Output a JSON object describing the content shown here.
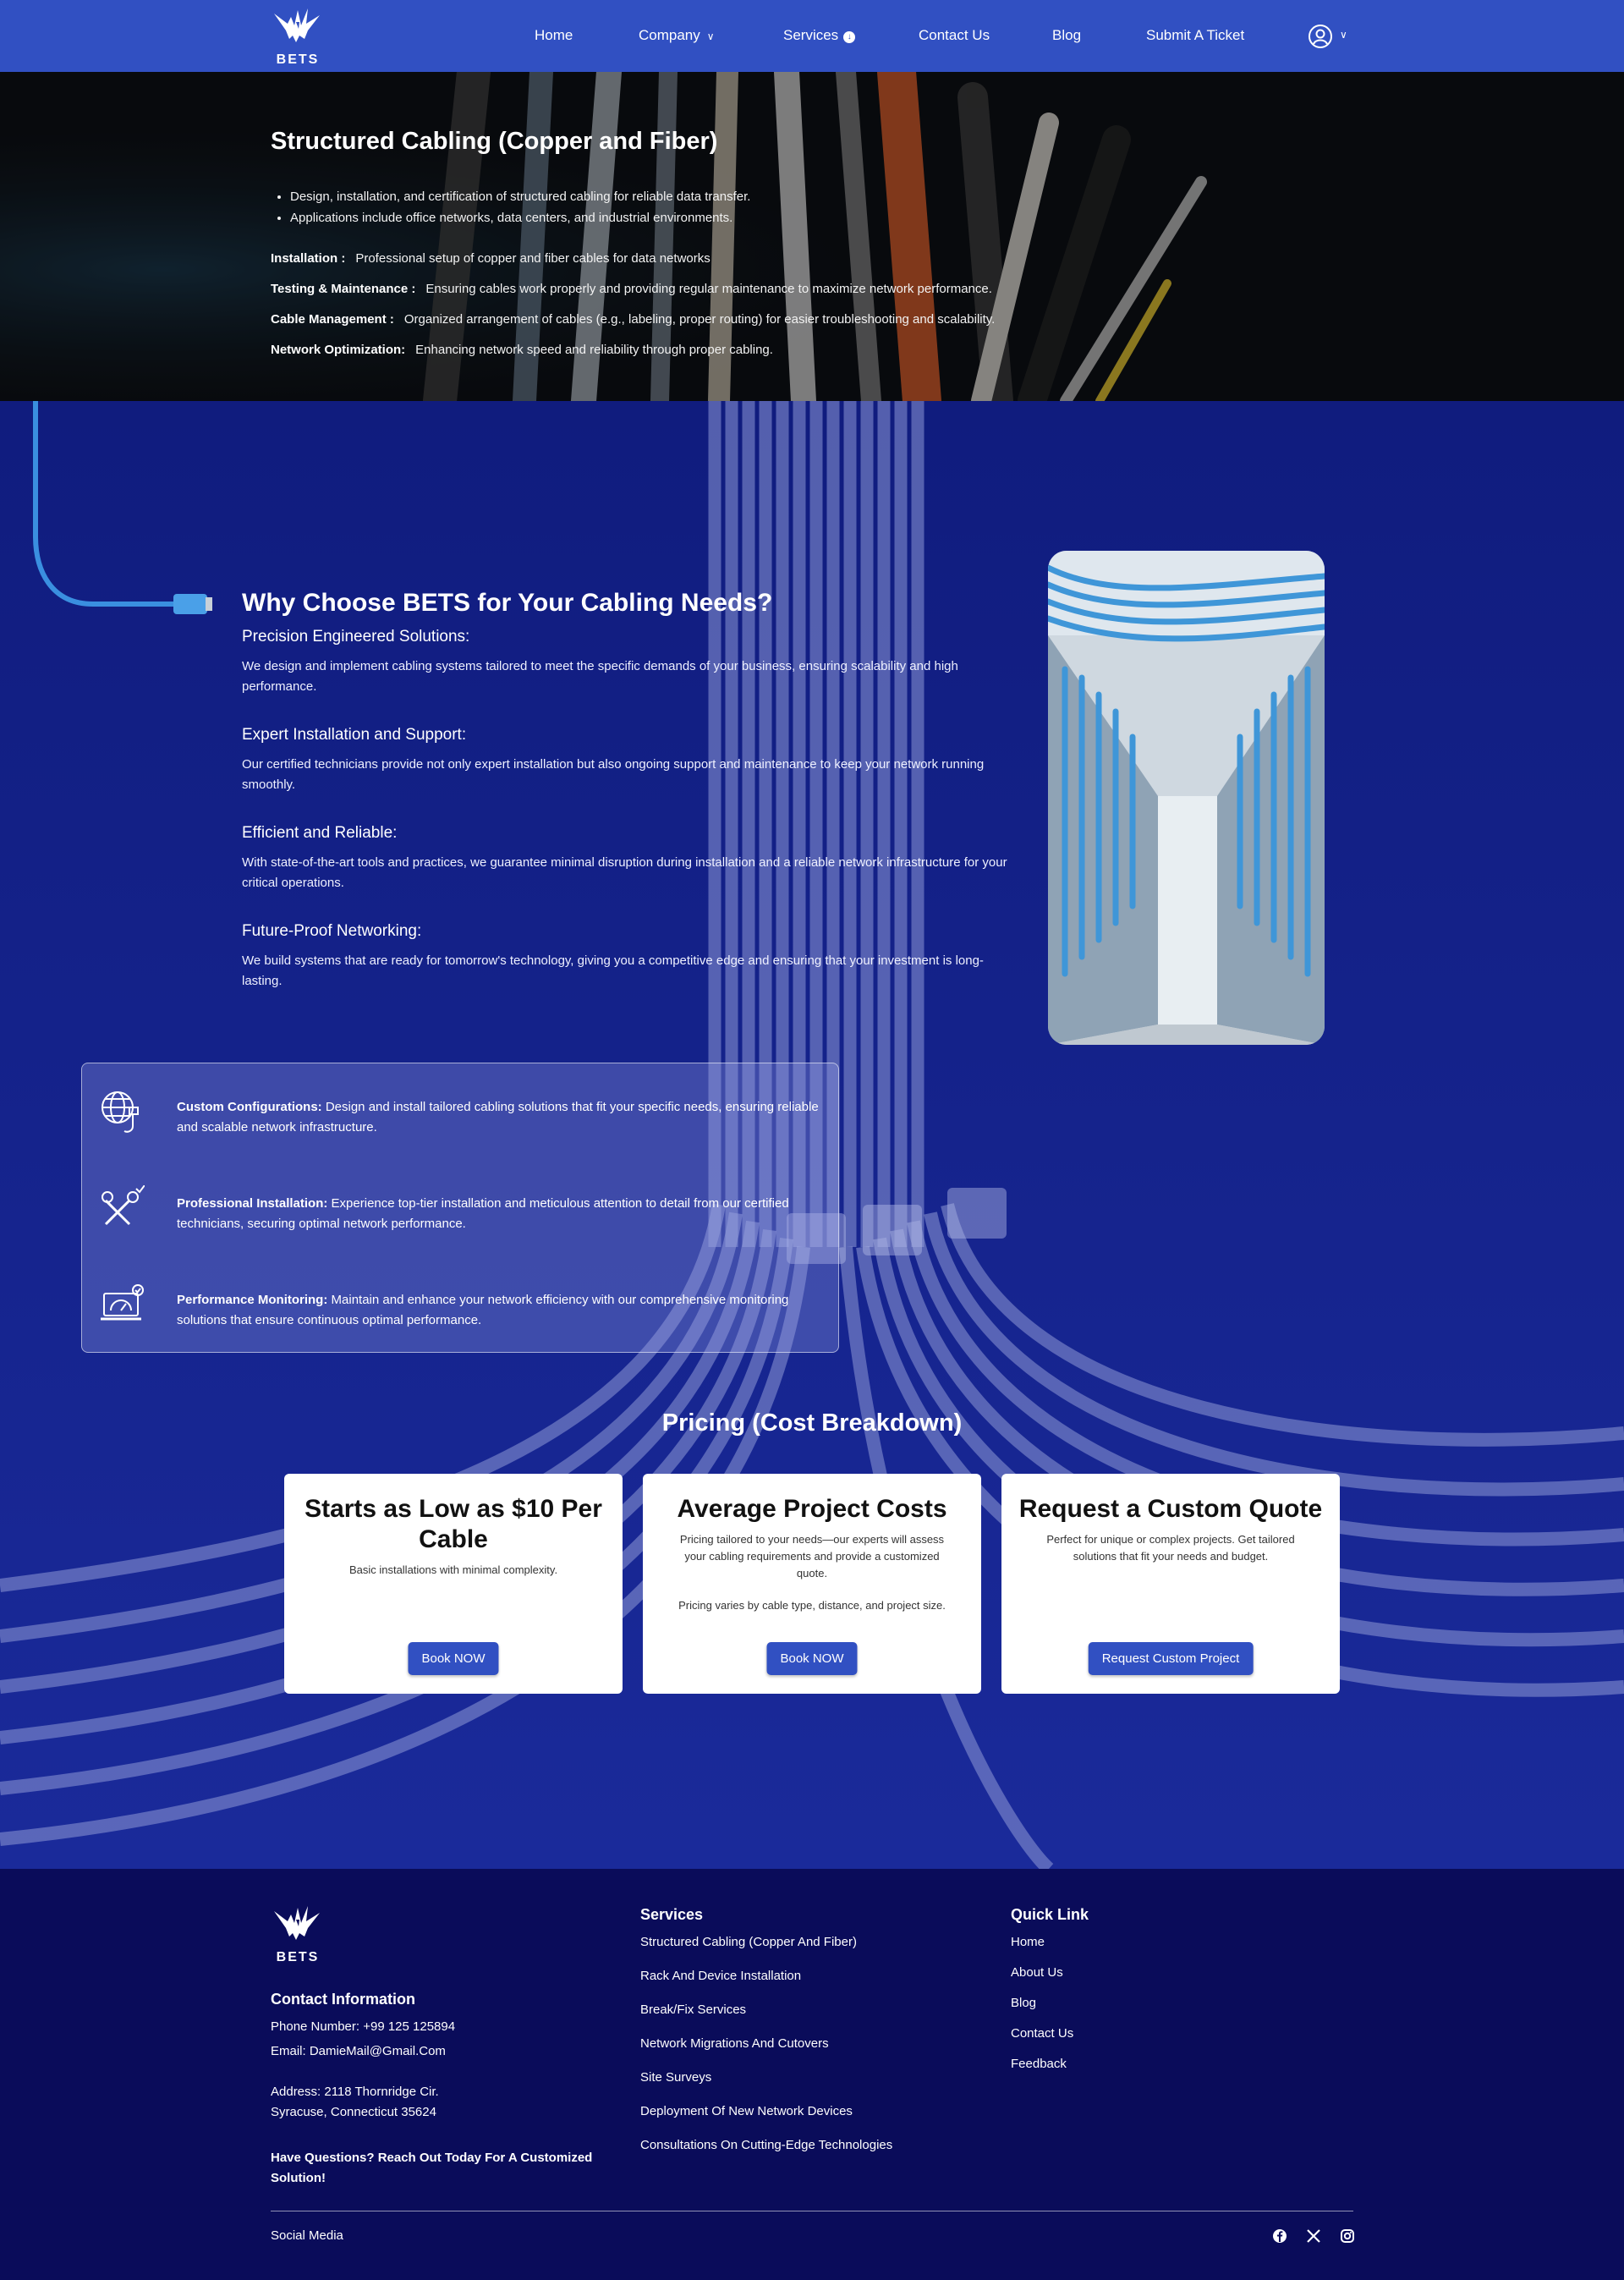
{
  "header": {
    "logo_text": "BETS",
    "nav": {
      "home": "Home",
      "company": "Company",
      "services": "Services",
      "contact": "Contact Us",
      "blog": "Blog",
      "ticket": "Submit A Ticket"
    }
  },
  "hero": {
    "title": "Structured Cabling (Copper and Fiber)",
    "bullets": [
      "Design, installation, and certification of structured cabling for reliable data transfer.",
      "Applications include office networks, data centers, and industrial environments."
    ],
    "rows": [
      {
        "label": "Installation :",
        "text": "Professional setup of copper and fiber cables for data networks"
      },
      {
        "label": "Testing & Maintenance :",
        "text": "Ensuring cables work properly and providing regular maintenance to maximize network performance."
      },
      {
        "label": "Cable Management :",
        "text": "Organized arrangement of cables (e.g., labeling, proper routing) for easier troubleshooting and scalability."
      },
      {
        "label": "Network Optimization:",
        "text": "Enhancing network speed and reliability through proper cabling."
      }
    ]
  },
  "why": {
    "title": "Why Choose BETS for Your Cabling Needs?",
    "items": [
      {
        "heading": "Precision Engineered Solutions:",
        "text": "We design and implement cabling systems tailored to meet the specific demands of your business, ensuring scalability and high performance."
      },
      {
        "heading": "Expert Installation and Support:",
        "text": "Our certified technicians provide not only expert installation but also ongoing support and maintenance to keep your network running smoothly."
      },
      {
        "heading": "Efficient and Reliable:",
        "text": "With state-of-the-art tools and practices, we guarantee minimal disruption during installation and a reliable network infrastructure for your critical operations."
      },
      {
        "heading": "Future-Proof Networking:",
        "text": "We build systems that are ready for tomorrow's technology, giving you a competitive edge and ensuring that your investment is long-lasting."
      }
    ]
  },
  "features": [
    {
      "icon": "globe-plug-icon",
      "title": "Custom Configurations:",
      "text": "Design and install tailored cabling solutions that fit your specific needs, ensuring reliable and scalable network infrastructure."
    },
    {
      "icon": "tools-icon",
      "title": "Professional Installation:",
      "text": "Experience top-tier installation and meticulous attention to detail from our certified technicians, securing optimal network performance."
    },
    {
      "icon": "laptop-gauge-icon",
      "title": "Performance Monitoring:",
      "text": "Maintain and enhance your network efficiency with our comprehensive monitoring solutions that ensure continuous optimal performance."
    }
  ],
  "pricing": {
    "title": "Pricing (Cost Breakdown)",
    "cards": [
      {
        "title": "Starts as Low as $10 Per Cable",
        "desc": "Basic installations with minimal complexity.",
        "note": "",
        "button": "Book NOW"
      },
      {
        "title": "Average Project Costs",
        "desc": "Pricing tailored to your needs—our experts will assess your cabling requirements and provide a customized quote.",
        "note": "Pricing varies by cable type, distance, and project size.",
        "button": "Book NOW"
      },
      {
        "title": "Request a Custom Quote",
        "desc": "Perfect for unique or complex projects. Get tailored solutions that fit your needs and budget.",
        "note": "",
        "button": "Request Custom Project"
      }
    ]
  },
  "footer": {
    "logo_text": "BETS",
    "contact_heading": "Contact Information",
    "phone": "Phone Number: +99 125 125894",
    "email": "Email: DamieMail@Gmail.Com",
    "address_line1": "Address: 2118 Thornridge Cir.",
    "address_line2": "Syracuse, Connecticut 35624",
    "cta": "Have Questions? Reach Out Today For A Customized Solution!",
    "services_heading": "Services",
    "services": [
      "Structured Cabling (Copper And Fiber)",
      "Rack And Device Installation",
      "Break/Fix Services",
      "Network Migrations And Cutovers",
      "Site Surveys",
      "Deployment Of New Network Devices",
      "Consultations On Cutting-Edge Technologies"
    ],
    "quick_heading": "Quick Link",
    "quick_links": [
      "Home",
      "About Us",
      "Blog",
      "Contact Us",
      "Feedback"
    ],
    "social_label": "Social Media",
    "social_icons": [
      "facebook-icon",
      "x-icon",
      "instagram-icon"
    ]
  },
  "colors": {
    "header_bg": "#3150c2",
    "main_bg": "#162285",
    "footer_bg": "#0a0c5a",
    "button_bg": "#3150c2"
  }
}
